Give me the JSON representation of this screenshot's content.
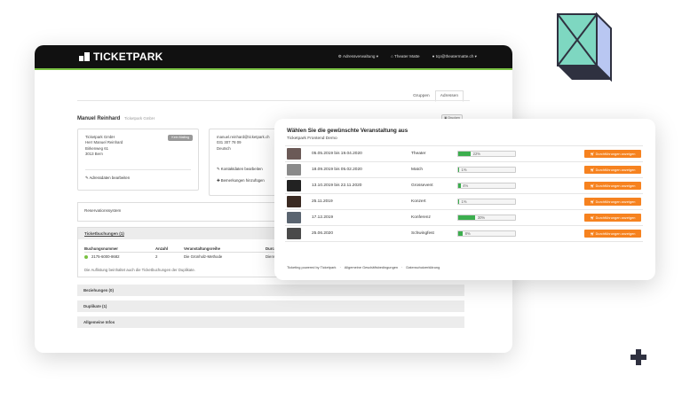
{
  "navbar": {
    "logo": "TICKETPARK",
    "items": [
      "Adressverwaltung",
      "Theater Matte",
      "tcp@theatermatte.ch"
    ]
  },
  "tabs": [
    "Gruppen",
    "Adressen"
  ],
  "person": {
    "name": "Manuel Reinhard",
    "org": "Ticketpark GmbH",
    "print": "Drucken"
  },
  "card1": {
    "badge": "Kein Mailing",
    "lines": [
      "Ticketpark GmbH",
      "Herr Manuel Reinhard",
      "Birkenweg 61",
      "3013 Bern"
    ],
    "link": "Adressdaten bearbeiten"
  },
  "card2": {
    "lines": [
      "manuel.reinhard@ticketpark.ch",
      "031 307 78 09",
      "Deutsch"
    ],
    "link1": "Kontaktdaten bearbeiten",
    "link2": "Bemerkungen hinzufügen"
  },
  "reservation": {
    "label": "Reservationssystem"
  },
  "ticketbuchungen": {
    "title": "Ticketbuchungen (1)",
    "headers": [
      "Buchungsnummer",
      "Anzahl",
      "Veranstaltungsreihe",
      "Durc"
    ],
    "rows": [
      [
        "2175-6000-8682",
        "2",
        "Die Grünholz-Methode",
        "Dienst"
      ]
    ],
    "note": "Die Auflistung beinhaltet auch die Ticketbuchungen der Duplikate."
  },
  "sections": [
    "Beziehungen (0)",
    "Duplikate (1)",
    "Allgemeine Infos"
  ],
  "popup": {
    "title": "Wählen Sie die gewünschte Veranstaltung aus",
    "subtitle": "Ticketpark Frontend Demo",
    "button_label": "Durchführungen anzeigen",
    "events": [
      {
        "date": "05.05.2019 bis 19.04.2020",
        "category": "Theater",
        "percent": 22,
        "percent_label": "22%",
        "thumb": "#6b5a57"
      },
      {
        "date": "18.09.2019 bis 05.02.2020",
        "category": "Match",
        "percent": 1,
        "percent_label": "1%",
        "thumb": "#8a8a8a"
      },
      {
        "date": "13.10.2019 bis 22.11.2020",
        "category": "Grossevent",
        "percent": 4,
        "percent_label": "4%",
        "thumb": "#222222"
      },
      {
        "date": "25.11.2019",
        "category": "Konzert",
        "percent": 1,
        "percent_label": "1%",
        "thumb": "#3a2a22"
      },
      {
        "date": "17.12.2019",
        "category": "Konferenz",
        "percent": 30,
        "percent_label": "30%",
        "thumb": "#5a6470"
      },
      {
        "date": "25.06.2020",
        "category": "Schwingfest",
        "percent": 8,
        "percent_label": "8%",
        "thumb": "#4a4a4a"
      }
    ],
    "footer": [
      "Ticketing powered by Ticketpark",
      "Allgemeine Geschäftsbedingungen",
      "Datenschutzerklärung"
    ]
  },
  "colors": {
    "accent_green": "#7ac143",
    "button_orange": "#f6821f",
    "progress_green": "#3cae4e",
    "cube_fill": "#7ed7c1",
    "cube_side": "#b9c7f2"
  },
  "icons": [
    "cube-icon",
    "plus-icon",
    "settings-icon",
    "building-icon",
    "user-icon",
    "cart-icon",
    "pencil-icon",
    "plus-small-icon",
    "print-icon"
  ]
}
